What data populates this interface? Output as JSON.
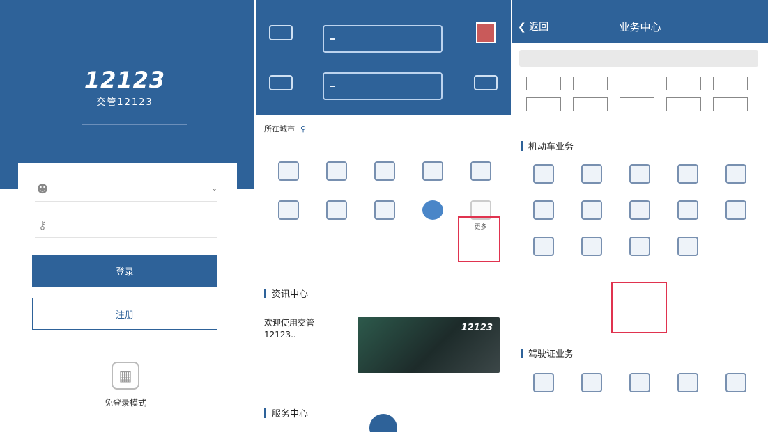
{
  "panel1": {
    "logo_text": "12123",
    "logo_sub": "交管12123",
    "login_button": "登录",
    "register_button": "注册",
    "free_login_label": "免登录模式"
  },
  "panel2": {
    "city_label": "所在城市",
    "news": {
      "section_title": "资讯中心",
      "text": "欢迎使用交管12123..",
      "image_text": "12123"
    },
    "service_section": "服务中心",
    "highlight_item": "更多"
  },
  "panel3": {
    "back_label": "返回",
    "title": "业务中心",
    "section_vehicle": "机动车业务",
    "section_license": "驾驶证业务"
  },
  "colors": {
    "brand_blue": "#2e6299",
    "highlight_red": "#e0334f"
  }
}
